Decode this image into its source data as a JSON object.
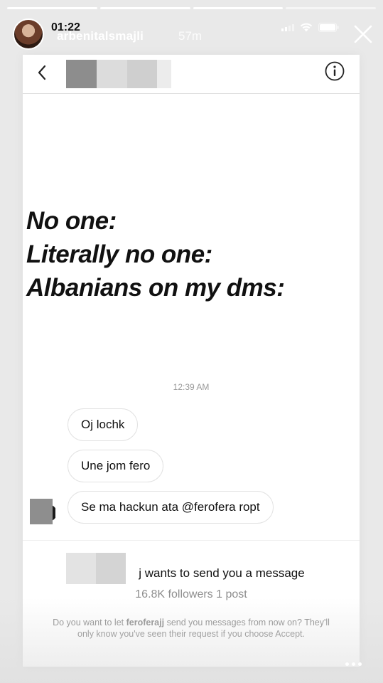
{
  "story": {
    "clock": "01:22",
    "username": "arbenitalsmajli",
    "age": "57m",
    "segments": 4,
    "completed_segments": 3
  },
  "dm": {
    "meme_lines": [
      "No one:",
      "Literally no one:",
      "Albanians on my dms:"
    ],
    "timestamp": "12:39 AM",
    "messages": [
      "Oj lochk",
      "Une jom fero",
      "Se ma hackun ata @ferofera ropt"
    ]
  },
  "request": {
    "title_suffix": "j wants to send you a message",
    "stats": "16.8K followers 1 post",
    "body_prefix": "Do you want to let ",
    "body_user": "feroferajj",
    "body_suffix": " send you messages from now on? They'll only know you've seen their request if you choose Accept."
  },
  "icons": {
    "back": "chevron-left-icon",
    "info": "info-icon",
    "close": "close-icon",
    "more": "more-dots-icon",
    "wifi": "wifi-icon",
    "battery": "battery-icon",
    "signal": "signal-icon"
  }
}
